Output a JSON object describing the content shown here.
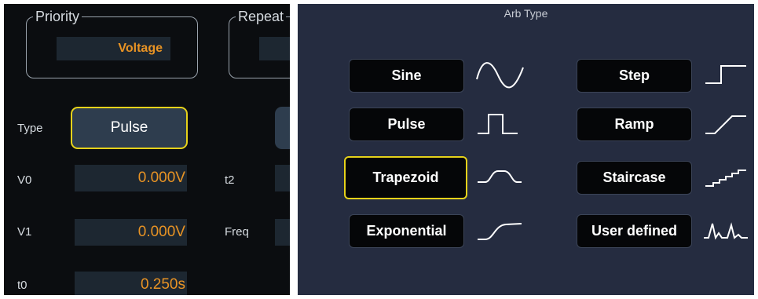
{
  "left_panel": {
    "priority": {
      "label": "Priority",
      "value": "Voltage"
    },
    "repeat": {
      "label": "Repeat"
    },
    "type": {
      "label": "Type",
      "value": "Pulse"
    },
    "rows": [
      {
        "label": "V0",
        "value": "0.000V"
      },
      {
        "label": "V1",
        "value": "0.000V"
      },
      {
        "label": "t0",
        "value": "0.250s"
      }
    ],
    "right_labels": {
      "t2": "t2",
      "freq": "Freq"
    }
  },
  "arb_type": {
    "title": "Arb Type",
    "options": [
      {
        "label": "Sine",
        "icon": "sine-wave-icon"
      },
      {
        "label": "Pulse",
        "icon": "pulse-wave-icon"
      },
      {
        "label": "Trapezoid",
        "icon": "trapezoid-wave-icon",
        "selected": true
      },
      {
        "label": "Exponential",
        "icon": "exponential-wave-icon"
      },
      {
        "label": "Step",
        "icon": "step-wave-icon"
      },
      {
        "label": "Ramp",
        "icon": "ramp-wave-icon"
      },
      {
        "label": "Staircase",
        "icon": "staircase-wave-icon"
      },
      {
        "label": "User defined",
        "icon": "user-defined-wave-icon"
      }
    ]
  },
  "colors": {
    "selection": "#e6d21a",
    "value_text": "#e89324",
    "right_bg": "#252c40"
  }
}
